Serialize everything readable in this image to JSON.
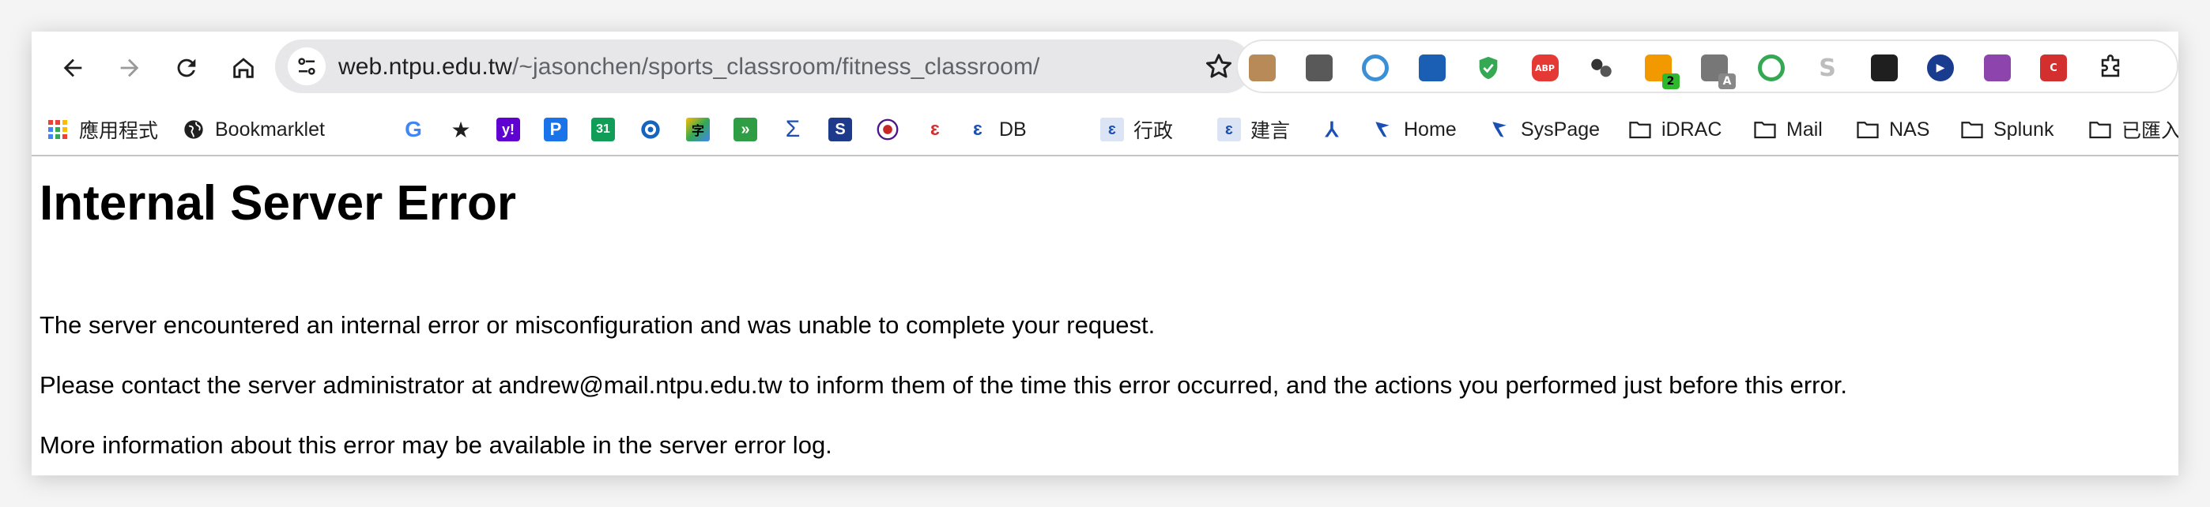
{
  "toolbar": {
    "back_icon": "arrow-left-icon",
    "forward_icon": "arrow-right-icon",
    "reload_icon": "reload-icon",
    "home_icon": "home-icon"
  },
  "omnibox": {
    "url_host": "web.ntpu.edu.tw",
    "url_path": "/~jasonchen/sports_classroom/fitness_classroom/",
    "bookmark_icon": "star-outline-icon"
  },
  "extensions": [
    {
      "name": "cookie-icon",
      "color": "#b88a57"
    },
    {
      "name": "bitwarden-icon",
      "color": "#595959"
    },
    {
      "name": "color-picker-icon",
      "color": "#3b8fd6"
    },
    {
      "name": "blue-book-icon",
      "color": "#1a5fb4"
    },
    {
      "name": "shield-check-icon",
      "color": "#34a853"
    },
    {
      "name": "adblock-plus-icon",
      "color": "#e53935",
      "text": "ABP"
    },
    {
      "name": "circles-icon",
      "color": "#333333"
    },
    {
      "name": "download-arrow-icon",
      "color": "#f29900",
      "badge": "2"
    },
    {
      "name": "translate-icon",
      "color": "#777777",
      "badge": "A"
    },
    {
      "name": "green-ring-icon",
      "color": "#34a853"
    },
    {
      "name": "gray-s-icon",
      "color": "#bdbdbd"
    },
    {
      "name": "tampermonkey-icon",
      "color": "#1f1f1f"
    },
    {
      "name": "play-circle-icon",
      "color": "#1a3c8f"
    },
    {
      "name": "purple-download-icon",
      "color": "#8e44ad"
    },
    {
      "name": "red-c-icon",
      "color": "#d32f2f",
      "text": "C"
    },
    {
      "name": "puzzle-icon",
      "color": "#1f1f1f"
    }
  ],
  "bookmarks": {
    "apps_label": "應用程式",
    "bookmarklet_label": "Bookmarklet",
    "db_label": "DB",
    "admin_label": "行政",
    "suggest_label": "建言",
    "home_label": "Home",
    "syspage_label": "SysPage",
    "idrac_label": "iDRAC",
    "mail_label": "Mail",
    "nas_label": "NAS",
    "splunk_label": "Splunk",
    "imported_label": "已匯入"
  },
  "error": {
    "title": "Internal Server Error",
    "line1": "The server encountered an internal error or misconfiguration and was unable to complete your request.",
    "line2": "Please contact the server administrator at andrew@mail.ntpu.edu.tw to inform them of the time this error occurred, and the actions you performed just before this error.",
    "line3": "More information about this error may be available in the server error log."
  }
}
